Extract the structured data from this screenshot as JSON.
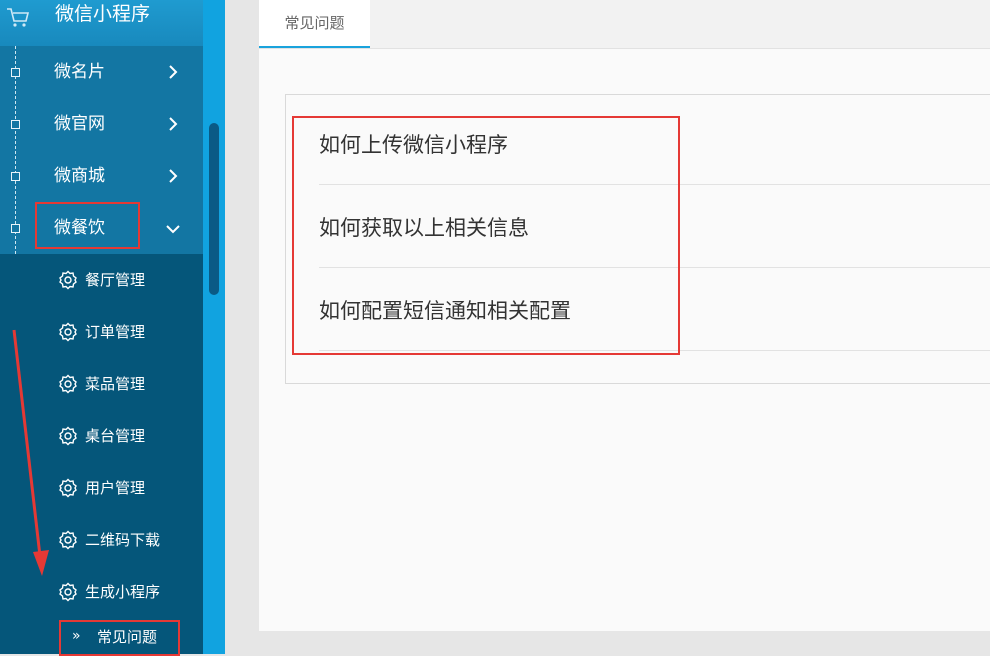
{
  "app": {
    "title": "微信小程序"
  },
  "sidebar": {
    "menu": [
      {
        "label": "微名片",
        "expanded": false
      },
      {
        "label": "微官网",
        "expanded": false
      },
      {
        "label": "微商城",
        "expanded": false
      },
      {
        "label": "微餐饮",
        "expanded": true
      }
    ],
    "submenu": [
      {
        "label": "餐厅管理"
      },
      {
        "label": "订单管理"
      },
      {
        "label": "菜品管理"
      },
      {
        "label": "桌台管理"
      },
      {
        "label": "用户管理"
      },
      {
        "label": "二维码下载"
      },
      {
        "label": "生成小程序"
      }
    ],
    "active_item": {
      "label": "常见问题",
      "marker": "»"
    }
  },
  "tabs": [
    {
      "label": "常见问题",
      "active": true
    }
  ],
  "faq": {
    "questions": [
      "如何上传微信小程序",
      "如何获取以上相关信息",
      "如何配置短信通知相关配置"
    ]
  },
  "colors": {
    "sidebar_bg": "#05567a",
    "menu_bg": "#1376a3",
    "accent": "#1aa3dc",
    "annotation": "#e53935"
  }
}
